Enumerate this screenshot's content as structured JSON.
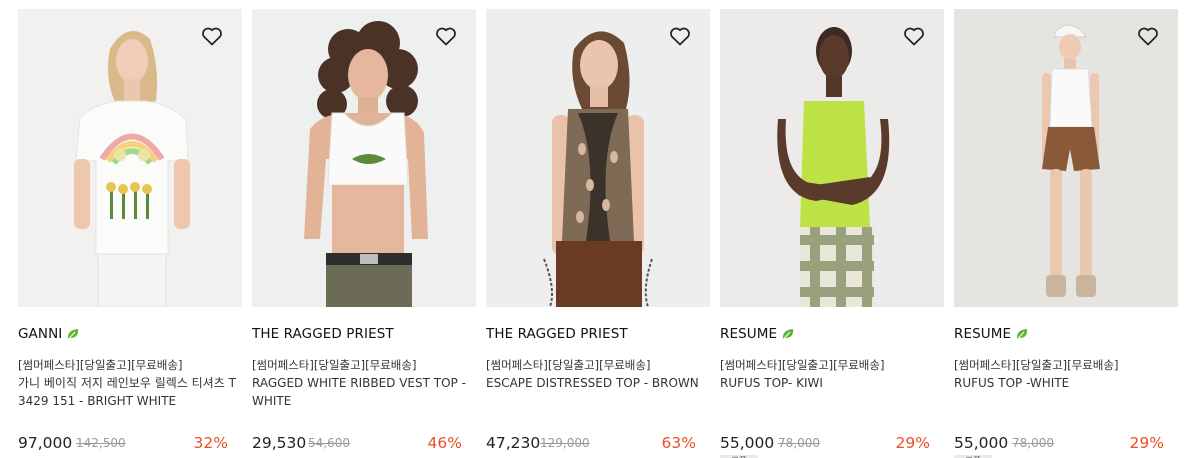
{
  "products": [
    {
      "brand": "GANNI",
      "eco": true,
      "tags": "[썸머페스타][당일출고][무료배송]",
      "name": "가니 베이직 저지 레인보우 릴렉스 티셔츠 T3429 151 - BRIGHT WHITE",
      "price": "97,000",
      "original_price": "142,500",
      "discount": "32%",
      "coupon": "",
      "bg_color": "#f2f1ef"
    },
    {
      "brand": "THE RAGGED PRIEST",
      "eco": false,
      "tags": "[썸머페스타][당일출고][무료배송]",
      "name": "RAGGED WHITE RIBBED VEST TOP - WHITE",
      "price": "29,530",
      "original_price": "54,600",
      "discount": "46%",
      "coupon": "",
      "bg_color": "#eef0ef"
    },
    {
      "brand": "THE RAGGED PRIEST",
      "eco": false,
      "tags": "[썸머페스타][당일출고][무료배송]",
      "name": "ESCAPE DISTRESSED TOP - BROWN",
      "price": "47,230",
      "original_price": "129,000",
      "discount": "63%",
      "coupon": "",
      "bg_color": "#eeeeee"
    },
    {
      "brand": "RESUME",
      "eco": true,
      "tags": "[썸머페스타][당일출고][무료배송]",
      "name": "RUFUS TOP- KIWI",
      "price": "55,000",
      "original_price": "78,000",
      "discount": "29%",
      "coupon": "쿠폰",
      "bg_color": "#ecebea"
    },
    {
      "brand": "RESUME",
      "eco": true,
      "tags": "[썸머페스타][당일출고][무료배송]",
      "name": "RUFUS TOP -WHITE",
      "price": "55,000",
      "original_price": "78,000",
      "discount": "29%",
      "coupon": "쿠폰",
      "bg_color": "#e6e4e1"
    }
  ],
  "icons": {
    "wishlist": "heart-outline-icon",
    "eco": "leaf-icon"
  },
  "colors": {
    "discount": "#e8502b",
    "leaf": "#5bb531",
    "original_price": "#999999"
  }
}
